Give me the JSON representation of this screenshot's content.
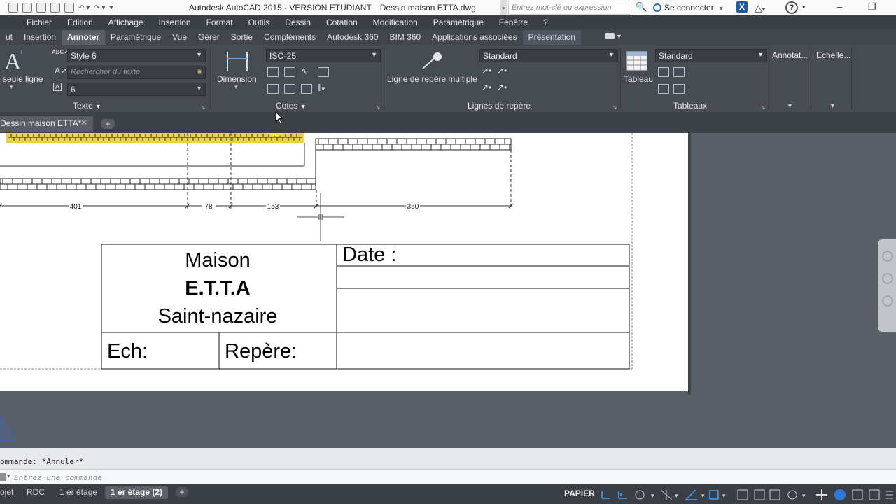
{
  "window": {
    "app_title": "Autodesk AutoCAD 2015 - VERSION ETUDIANT",
    "file_title": "Dessin maison ETTA.dwg",
    "search_placeholder": "Entrez mot-clé ou expression",
    "signin_label": "Se connecter",
    "help_label": "?"
  },
  "menubar": {
    "items": [
      "Fichier",
      "Edition",
      "Affichage",
      "Insertion",
      "Format",
      "Outils",
      "Dessin",
      "Cotation",
      "Modification",
      "Paramétrique",
      "Fenêtre",
      "?"
    ]
  },
  "ribbon_tabs": {
    "items": [
      "ut",
      "Insertion",
      "Annoter",
      "Paramétrique",
      "Vue",
      "Gérer",
      "Sortie",
      "Compléments",
      "Autodesk 360",
      "BIM 360",
      "Applications associées",
      "Présentation"
    ],
    "active": "Annoter"
  },
  "ribbon": {
    "text_panel": {
      "label": "Texte",
      "single_line_label": "seule ligne",
      "style_value": "Style 6",
      "search_placeholder": "Rechercher du texte",
      "height_value": "6"
    },
    "dimension_panel": {
      "label": "Cotes",
      "dimension_label": "Dimension",
      "style_value": "ISO-25"
    },
    "leader_panel": {
      "label": "Lignes de repère",
      "multileader_label": "Ligne de repère multiple",
      "style_value": "Standard"
    },
    "table_panel": {
      "label": "Tableaux",
      "table_label": "Tableau",
      "style_value": "Standard"
    },
    "annot_label": "Annotat...",
    "scale_label": "Echelle..."
  },
  "file_tabs": {
    "active_tab": "Dessin maison ETTA*",
    "new_tab": "+"
  },
  "drawing": {
    "dimensions": [
      "401",
      "78",
      "153",
      "350"
    ],
    "title_block": {
      "line1": "Maison",
      "line2": "E.T.T.A",
      "line3": "Saint-nazaire",
      "date_label": "Date :",
      "scale_label": "Ech:",
      "ref_label": "Repère:"
    }
  },
  "command": {
    "history": "ommande: *Annuler*",
    "placeholder": "Entrez une commande"
  },
  "status": {
    "layout_tabs": [
      "ojet",
      "RDC",
      "1 er étage",
      "1 er étage (2)"
    ],
    "active_layout": "1 er étage (2)",
    "add_layout": "+",
    "space_label": "PAPIER"
  }
}
